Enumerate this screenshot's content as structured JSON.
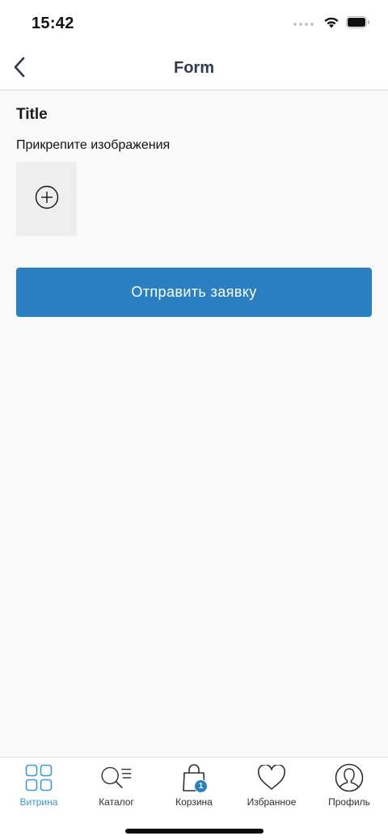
{
  "status_bar": {
    "time": "15:42"
  },
  "nav": {
    "title": "Form",
    "back_icon": "chevron-left-icon"
  },
  "form": {
    "title": "Title",
    "attach_label": "Прикрепите изображения",
    "add_icon": "plus-circle-icon",
    "submit_label": "Отправить заявку"
  },
  "tab_bar": {
    "tabs": [
      {
        "label": "Витрина",
        "icon": "grid-icon",
        "active": true
      },
      {
        "label": "Каталог",
        "icon": "search-list-icon",
        "active": false
      },
      {
        "label": "Корзина",
        "icon": "shopping-bag-icon",
        "active": false,
        "badge": "1"
      },
      {
        "label": "Избранное",
        "icon": "heart-icon",
        "active": false
      },
      {
        "label": "Профиль",
        "icon": "user-icon",
        "active": false
      }
    ]
  },
  "colors": {
    "accent": "#2a80c0",
    "active_tab": "#3a98d6",
    "background": "#f9f9f9"
  }
}
